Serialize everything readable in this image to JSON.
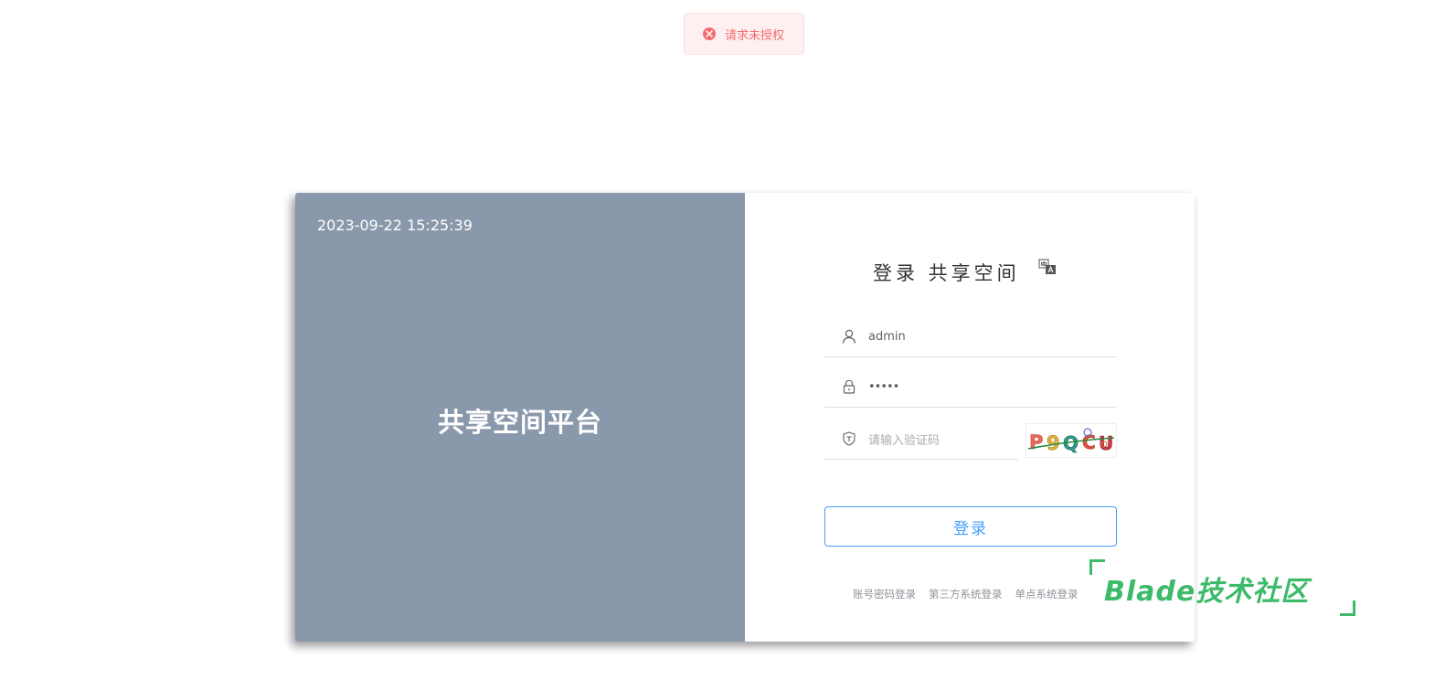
{
  "toast": {
    "type": "error",
    "icon": "error-circle-icon",
    "message": "请求未授权",
    "color": "#f56c6c"
  },
  "left_panel": {
    "datetime": "2023-09-22 15:25:39",
    "platform_name": "共享空间平台",
    "background": "#8a98ab"
  },
  "login": {
    "title": "登录 共享空间",
    "language_icon": "translate-icon",
    "username": {
      "icon": "user-icon",
      "value": "admin"
    },
    "password": {
      "icon": "lock-icon",
      "value": "•••••"
    },
    "captcha": {
      "icon": "shield-icon",
      "placeholder": "请输入验证码",
      "image_text": "P9QCU"
    },
    "submit_label": "登录",
    "accent": "#409eff",
    "alt_logins": [
      "账号密码登录",
      "第三方系统登录",
      "单点系统登录"
    ]
  },
  "watermark": {
    "text": "Blade技术社区",
    "color": "#3dba6a"
  }
}
